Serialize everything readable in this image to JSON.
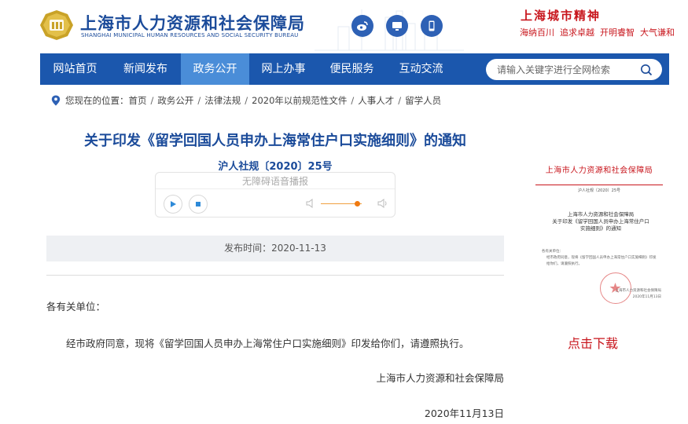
{
  "header": {
    "logo_cn": "上海市人力资源和社会保障局",
    "logo_en": "SHANGHAI MUNICIPAL HUMAN RESOURCES AND SOCIAL SECURITY BUREAU",
    "social_icons": [
      "weibo-icon",
      "desktop-icon",
      "mobile-icon"
    ],
    "spirit_title": "上海城市精神",
    "spirit_phrases": [
      "海纳百川",
      "追求卓越",
      "开明睿智",
      "大气谦和"
    ]
  },
  "nav": {
    "items": [
      {
        "label": "网站首页",
        "active": false
      },
      {
        "label": "新闻发布",
        "active": false
      },
      {
        "label": "政务公开",
        "active": true
      },
      {
        "label": "网上办事",
        "active": false
      },
      {
        "label": "便民服务",
        "active": false
      },
      {
        "label": "互动交流",
        "active": false
      }
    ],
    "search_placeholder": "请输入关键字进行全网检索"
  },
  "breadcrumb": {
    "prefix": "您现在的位置：",
    "items": [
      "首页",
      "政务公开",
      "法律法规",
      "2020年以前规范性文件",
      "人事人才",
      "留学人员"
    ]
  },
  "article": {
    "title": "关于印发《留学回国人员申办上海常住户口实施细则》的通知",
    "doc_number": "沪人社规〔2020〕25号",
    "audio_label": "无障碍语音播报",
    "volume_fraction": 0.9,
    "publish_time": "发布时间：2020-11-13",
    "salutation": "各有关单位：",
    "body": "经市政府同意，现将《留学回国人员申办上海常住户口实施细则》印发给你们，请遵照执行。",
    "signature": "上海市人力资源和社会保障局",
    "date": "2020年11月13日"
  },
  "sidebar": {
    "thumb_header": "上海市人力资源和社会保障局",
    "thumb_number": "沪人社规〔2020〕25号",
    "thumb_title_lines": [
      "上海市人力资源和社会保障局",
      "关于印发《留学回国人员申办上海常住户口",
      "实施细则》的通知"
    ],
    "thumb_salutation": "各有关单位：",
    "thumb_body": "经市政府同意，现将《留学回国人员申办上海常住户口实施细则》印发给你们，请遵照执行。",
    "thumb_signature": "上海市人力资源和社会保障局",
    "thumb_date": "2020年11月13日",
    "download_label": "点击下载"
  },
  "colors": {
    "brand_blue": "#1b57ad",
    "nav_active": "#4a8dd8",
    "title_blue": "#1b4b9a",
    "accent_red": "#c8161d"
  }
}
